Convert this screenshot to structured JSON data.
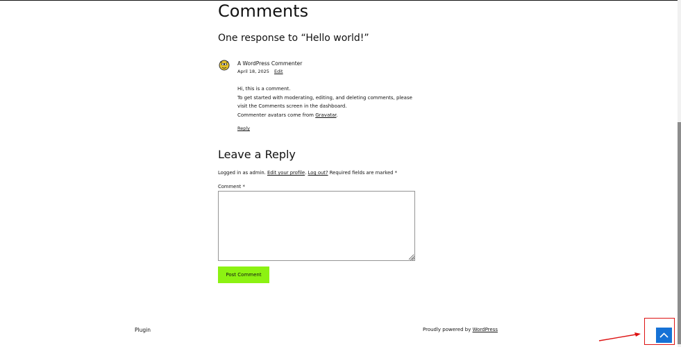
{
  "comments": {
    "heading": "Comments",
    "response_title": "One response to “Hello world!”",
    "items": [
      {
        "author": "A WordPress Commenter",
        "date": "April 18, 2025",
        "edit_label": "Edit",
        "body_line1": "Hi, this is a comment.",
        "body_line2": "To get started with moderating, editing, and deleting comments, please visit the Comments screen in the dashboard.",
        "body_line3_prefix": "Commenter avatars come from ",
        "body_line3_link": "Gravatar",
        "body_line3_suffix": ".",
        "reply_label": "Reply"
      }
    ]
  },
  "reply_form": {
    "heading": "Leave a Reply",
    "logged_prefix": "Logged in as admin. ",
    "edit_profile_label": "Edit your profile",
    "sep": ". ",
    "logout_label": "Log out?",
    "required_text": " Required fields are marked *",
    "comment_label": "Comment *",
    "comment_value": "",
    "submit_label": "Post Comment"
  },
  "footer": {
    "left_text": "Plugin",
    "powered_prefix": "Proudly powered by ",
    "powered_link": "WordPress"
  },
  "colors": {
    "submit_bg": "#8cf212",
    "scroll_top_bg": "#1672d6",
    "annotation": "#dd1111"
  },
  "icons": {
    "avatar": "commenter-avatar-icon",
    "scroll_top": "chevron-up-icon"
  }
}
